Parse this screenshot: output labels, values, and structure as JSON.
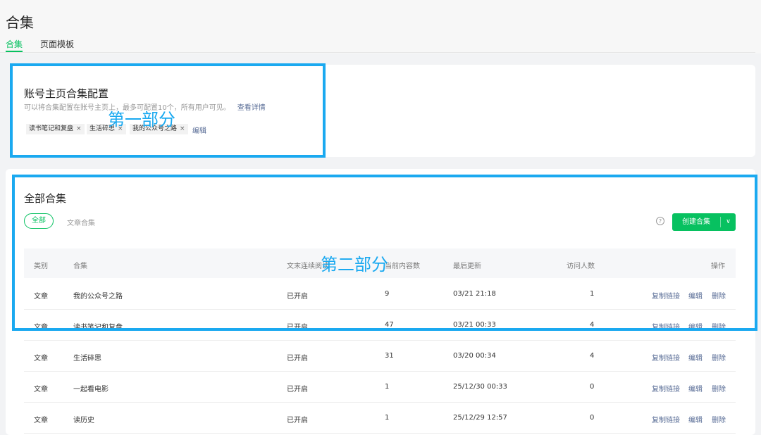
{
  "page": {
    "title": "合集",
    "tabs": [
      {
        "label": "合集",
        "active": true
      },
      {
        "label": "页面模板",
        "active": false
      }
    ]
  },
  "homepage_config": {
    "title": "账号主页合集配置",
    "description": "可以将合集配置在账号主页上，最多可配置10个，所有用户可见。",
    "details_link": "查看详情",
    "chips": [
      {
        "label": "读书笔记和复盘",
        "close": "×"
      },
      {
        "label": "生活碎思",
        "close": "×"
      },
      {
        "label": "我的公众号之路",
        "close": "×"
      }
    ],
    "edit_label": "编辑"
  },
  "all_collections": {
    "title": "全部合集",
    "filters": {
      "all": "全部",
      "article": "文章合集"
    },
    "help_icon": "?",
    "create_label": "创建合集",
    "create_chevron": "∨",
    "columns": {
      "type": "类别",
      "collection": "合集",
      "continuous_reading": "文末连续阅读",
      "content_count": "当前内容数",
      "last_updated": "最后更新",
      "visitors": "访问人数",
      "actions": "操作"
    },
    "rows": [
      {
        "type": "文章",
        "name": "我的公众号之路",
        "reading": "已开启",
        "count": "9",
        "updated": "03/21 21:18",
        "visitors": "1"
      },
      {
        "type": "文章",
        "name": "读书笔记和复盘",
        "reading": "已开启",
        "count": "47",
        "updated": "03/21 00:33",
        "visitors": "4"
      },
      {
        "type": "文章",
        "name": "生活碎思",
        "reading": "已开启",
        "count": "31",
        "updated": "03/20 00:34",
        "visitors": "4"
      },
      {
        "type": "文章",
        "name": "一起看电影",
        "reading": "已开启",
        "count": "1",
        "updated": "25/12/30 00:33",
        "visitors": "0"
      },
      {
        "type": "文章",
        "name": "读历史",
        "reading": "已开启",
        "count": "1",
        "updated": "25/12/29 12:57",
        "visitors": "0"
      }
    ],
    "row_actions": {
      "copy_link": "复制链接",
      "edit": "编辑",
      "delete": "删除"
    }
  },
  "annotations": {
    "part1": "第一部分",
    "part2": "第二部分"
  },
  "colors": {
    "accent": "#07c160",
    "link": "#576b95",
    "annotation": "#1aa9f0"
  }
}
